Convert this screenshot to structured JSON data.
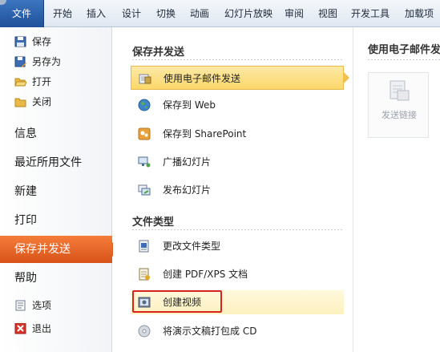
{
  "ribbon": {
    "tabs": [
      {
        "label": "文件"
      },
      {
        "label": "开始"
      },
      {
        "label": "插入"
      },
      {
        "label": "设计"
      },
      {
        "label": "切换"
      },
      {
        "label": "动画"
      },
      {
        "label": "幻灯片放映"
      },
      {
        "label": "审阅"
      },
      {
        "label": "视图"
      },
      {
        "label": "开发工具"
      },
      {
        "label": "加载项"
      }
    ]
  },
  "nav": {
    "commands": [
      {
        "label": "保存",
        "icon": "save-icon"
      },
      {
        "label": "另存为",
        "icon": "save-as-icon"
      },
      {
        "label": "打开",
        "icon": "open-folder-icon"
      },
      {
        "label": "关闭",
        "icon": "close-folder-icon"
      }
    ],
    "tabs": [
      {
        "label": "信息"
      },
      {
        "label": "最近所用文件"
      },
      {
        "label": "新建"
      },
      {
        "label": "打印"
      },
      {
        "label": "保存并发送"
      },
      {
        "label": "帮助"
      }
    ],
    "bottom": [
      {
        "label": "选项",
        "icon": "options-icon"
      },
      {
        "label": "退出",
        "icon": "exit-icon"
      }
    ]
  },
  "save_send": {
    "heading": "保存并发送",
    "items": [
      {
        "label": "使用电子邮件发送",
        "icon": "email-icon"
      },
      {
        "label": "保存到 Web",
        "icon": "globe-icon"
      },
      {
        "label": "保存到 SharePoint",
        "icon": "sharepoint-icon"
      },
      {
        "label": "广播幻灯片",
        "icon": "broadcast-icon"
      },
      {
        "label": "发布幻灯片",
        "icon": "publish-icon"
      }
    ]
  },
  "file_types": {
    "heading": "文件类型",
    "items": [
      {
        "label": "更改文件类型",
        "icon": "change-file-type-icon"
      },
      {
        "label": "创建 PDF/XPS 文档",
        "icon": "pdf-icon"
      },
      {
        "label": "创建视频",
        "icon": "video-icon"
      },
      {
        "label": "将演示文稿打包成 CD",
        "icon": "cd-icon"
      }
    ]
  },
  "details": {
    "heading": "使用电子邮件发",
    "button_label": "发送链接"
  },
  "colors": {
    "file_tab": "#2a5ea8",
    "active_nav": "#e8652a",
    "selected_item": "#fbd86a",
    "highlight_box": "#d9241c"
  }
}
